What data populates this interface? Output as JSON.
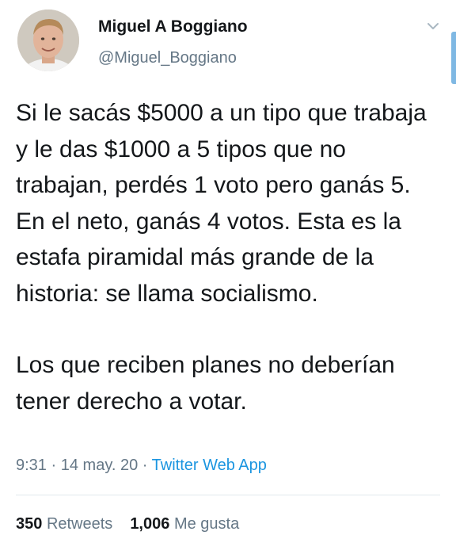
{
  "user": {
    "display_name": "Miguel A Boggiano",
    "handle": "@Miguel_Boggiano"
  },
  "tweet": {
    "paragraphs": [
      "Si le sacás $5000 a un tipo que trabaja y le das $1000 a 5 tipos que no trabajan, perdés 1 voto pero ganás 5. En el neto, ganás 4 votos. Esta es la estafa piramidal más grande de la historia: se llama socialismo.",
      "Los que reciben planes no deberían tener derecho a votar."
    ],
    "time": "9:31",
    "date": "14 may. 20",
    "separator": "·",
    "source": "Twitter Web App"
  },
  "stats": {
    "retweets_count": "350",
    "retweets_label": "Retweets",
    "likes_count": "1,006",
    "likes_label": "Me gusta"
  },
  "icons": {
    "menu": "chevron-down-icon",
    "avatar": "profile-photo"
  },
  "colors": {
    "text": "#14171a",
    "secondary": "#657786",
    "link": "#1b95e0",
    "divider": "#e1e8ed"
  }
}
